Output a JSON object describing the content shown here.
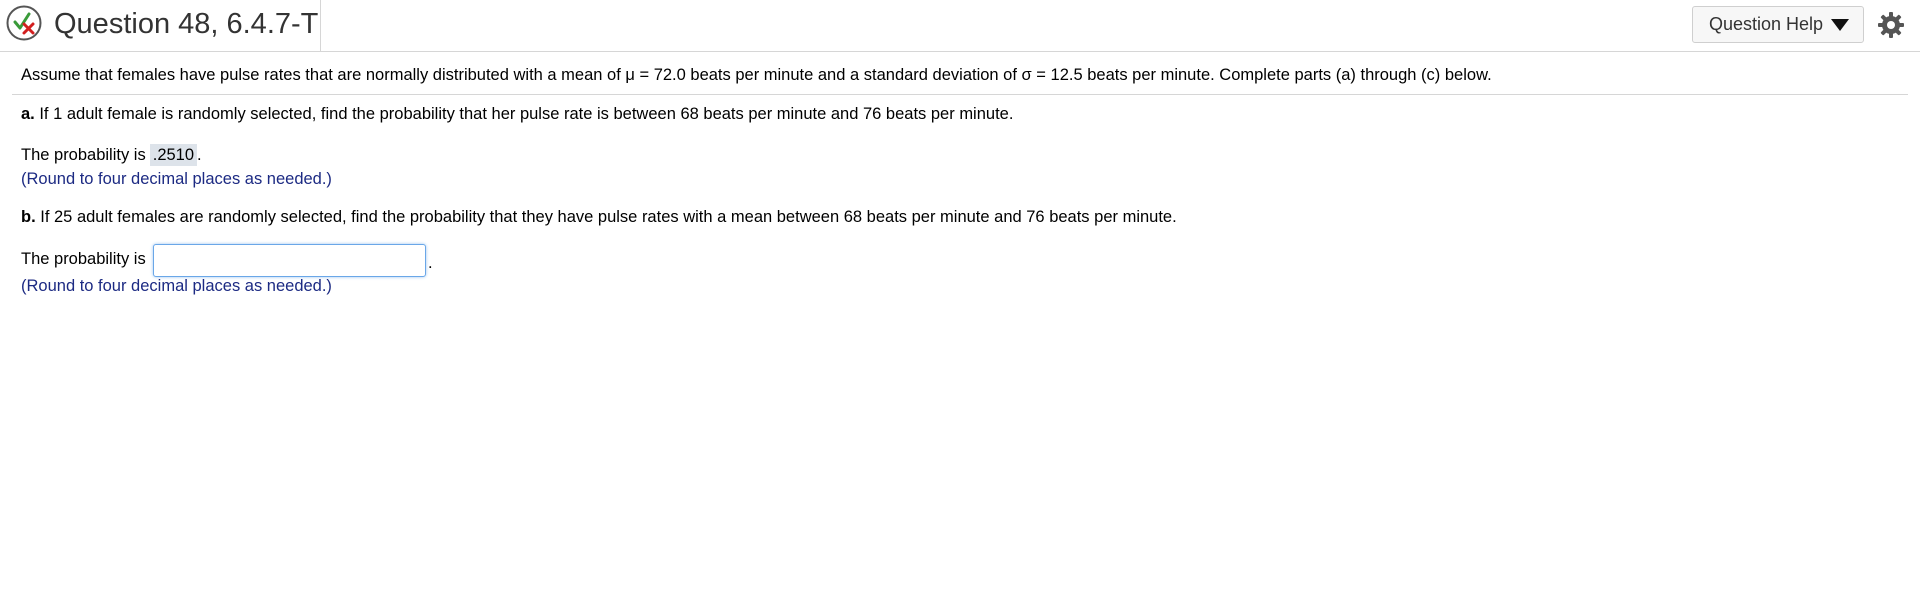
{
  "header": {
    "title": "Question 48, 6.4.7-T",
    "help_label": "Question Help",
    "status_icon": "check-x-icon",
    "settings_icon": "gear-icon"
  },
  "stem": {
    "text": "Assume that females have pulse rates that are normally distributed with a mean of μ = 72.0 beats per minute and a standard deviation of σ = 12.5 beats per minute. Complete parts (a) through (c) below."
  },
  "part_a": {
    "label": "a.",
    "question": " If 1 adult female is randomly selected, find the probability that her pulse rate is between 68 beats per minute and 76 beats per minute.",
    "answer_prefix": "The probability is",
    "answer_value": ".2510",
    "answer_suffix": ".",
    "hint": "(Round to four decimal places as needed.)"
  },
  "part_b": {
    "label": "b.",
    "question": " If 25 adult females are randomly selected, find the probability that they have pulse rates with a mean between 68 beats per minute and 76 beats per minute.",
    "answer_prefix": "The probability is",
    "answer_value": "",
    "answer_suffix": ".",
    "hint": "(Round to four decimal places as needed.)"
  },
  "colors": {
    "hint": "#1c2a83",
    "input_border": "#6aa7e8",
    "answered_bg": "#dde3ea"
  }
}
